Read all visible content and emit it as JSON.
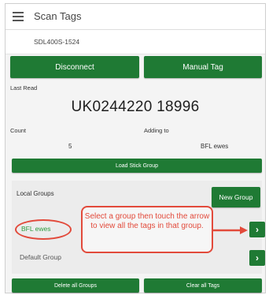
{
  "header": {
    "title": "Scan Tags"
  },
  "device": {
    "id": "SDL400S-1524"
  },
  "actions": {
    "disconnect_label": "Disconnect",
    "manual_tag_label": "Manual Tag"
  },
  "last_read": {
    "label": "Last Read",
    "tag_number": "UK0244220 18996"
  },
  "count": {
    "label": "Count",
    "value": "5"
  },
  "adding_to": {
    "label": "Adding to",
    "value": "BFL ewes"
  },
  "load_stick_group_label": "Load Stick Group",
  "local_groups": {
    "title": "Local Groups",
    "new_group_label": "New Group",
    "groups": [
      {
        "name": "BFL ewes",
        "selected": true
      },
      {
        "name": "Default Group",
        "selected": false
      }
    ]
  },
  "annotation": {
    "text": "Select a group then touch the arrow to view all the tags in that group."
  },
  "footer": {
    "delete_all_label": "Delete all Groups",
    "clear_all_label": "Clear all Tags"
  },
  "colors": {
    "primary_green": "#1f7a34",
    "annotation_red": "#e24a3b",
    "selected_group_text": "#2e9b3e"
  }
}
